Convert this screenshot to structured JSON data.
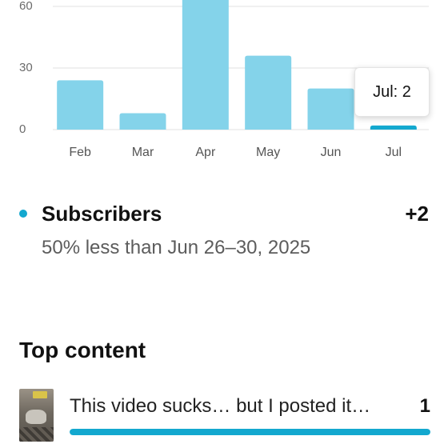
{
  "chart_data": {
    "type": "bar",
    "categories": [
      "Feb",
      "Mar",
      "Apr",
      "May",
      "Jun",
      "Jul"
    ],
    "values": [
      24,
      8,
      75,
      36,
      20,
      2
    ],
    "yticks": [
      0,
      30,
      60
    ],
    "ylim": [
      0,
      70
    ],
    "highlighted_category": "Jul",
    "bar_color": "#84d3ea",
    "highlight_color": "#13a8cf",
    "grid": true
  },
  "tooltip": {
    "text": "Jul: 2"
  },
  "metric": {
    "label": "Subscribers",
    "value": "+2",
    "comparison": "50% less than Jun 26–30, 2025",
    "dot_color": "#13a8cf"
  },
  "top_content": {
    "title": "Top content",
    "items": [
      {
        "title": "This video sucks… but I posted it…",
        "value": "1",
        "bar_fraction": 1.0,
        "thumbnail_icon": "video-thumbnail"
      }
    ]
  }
}
